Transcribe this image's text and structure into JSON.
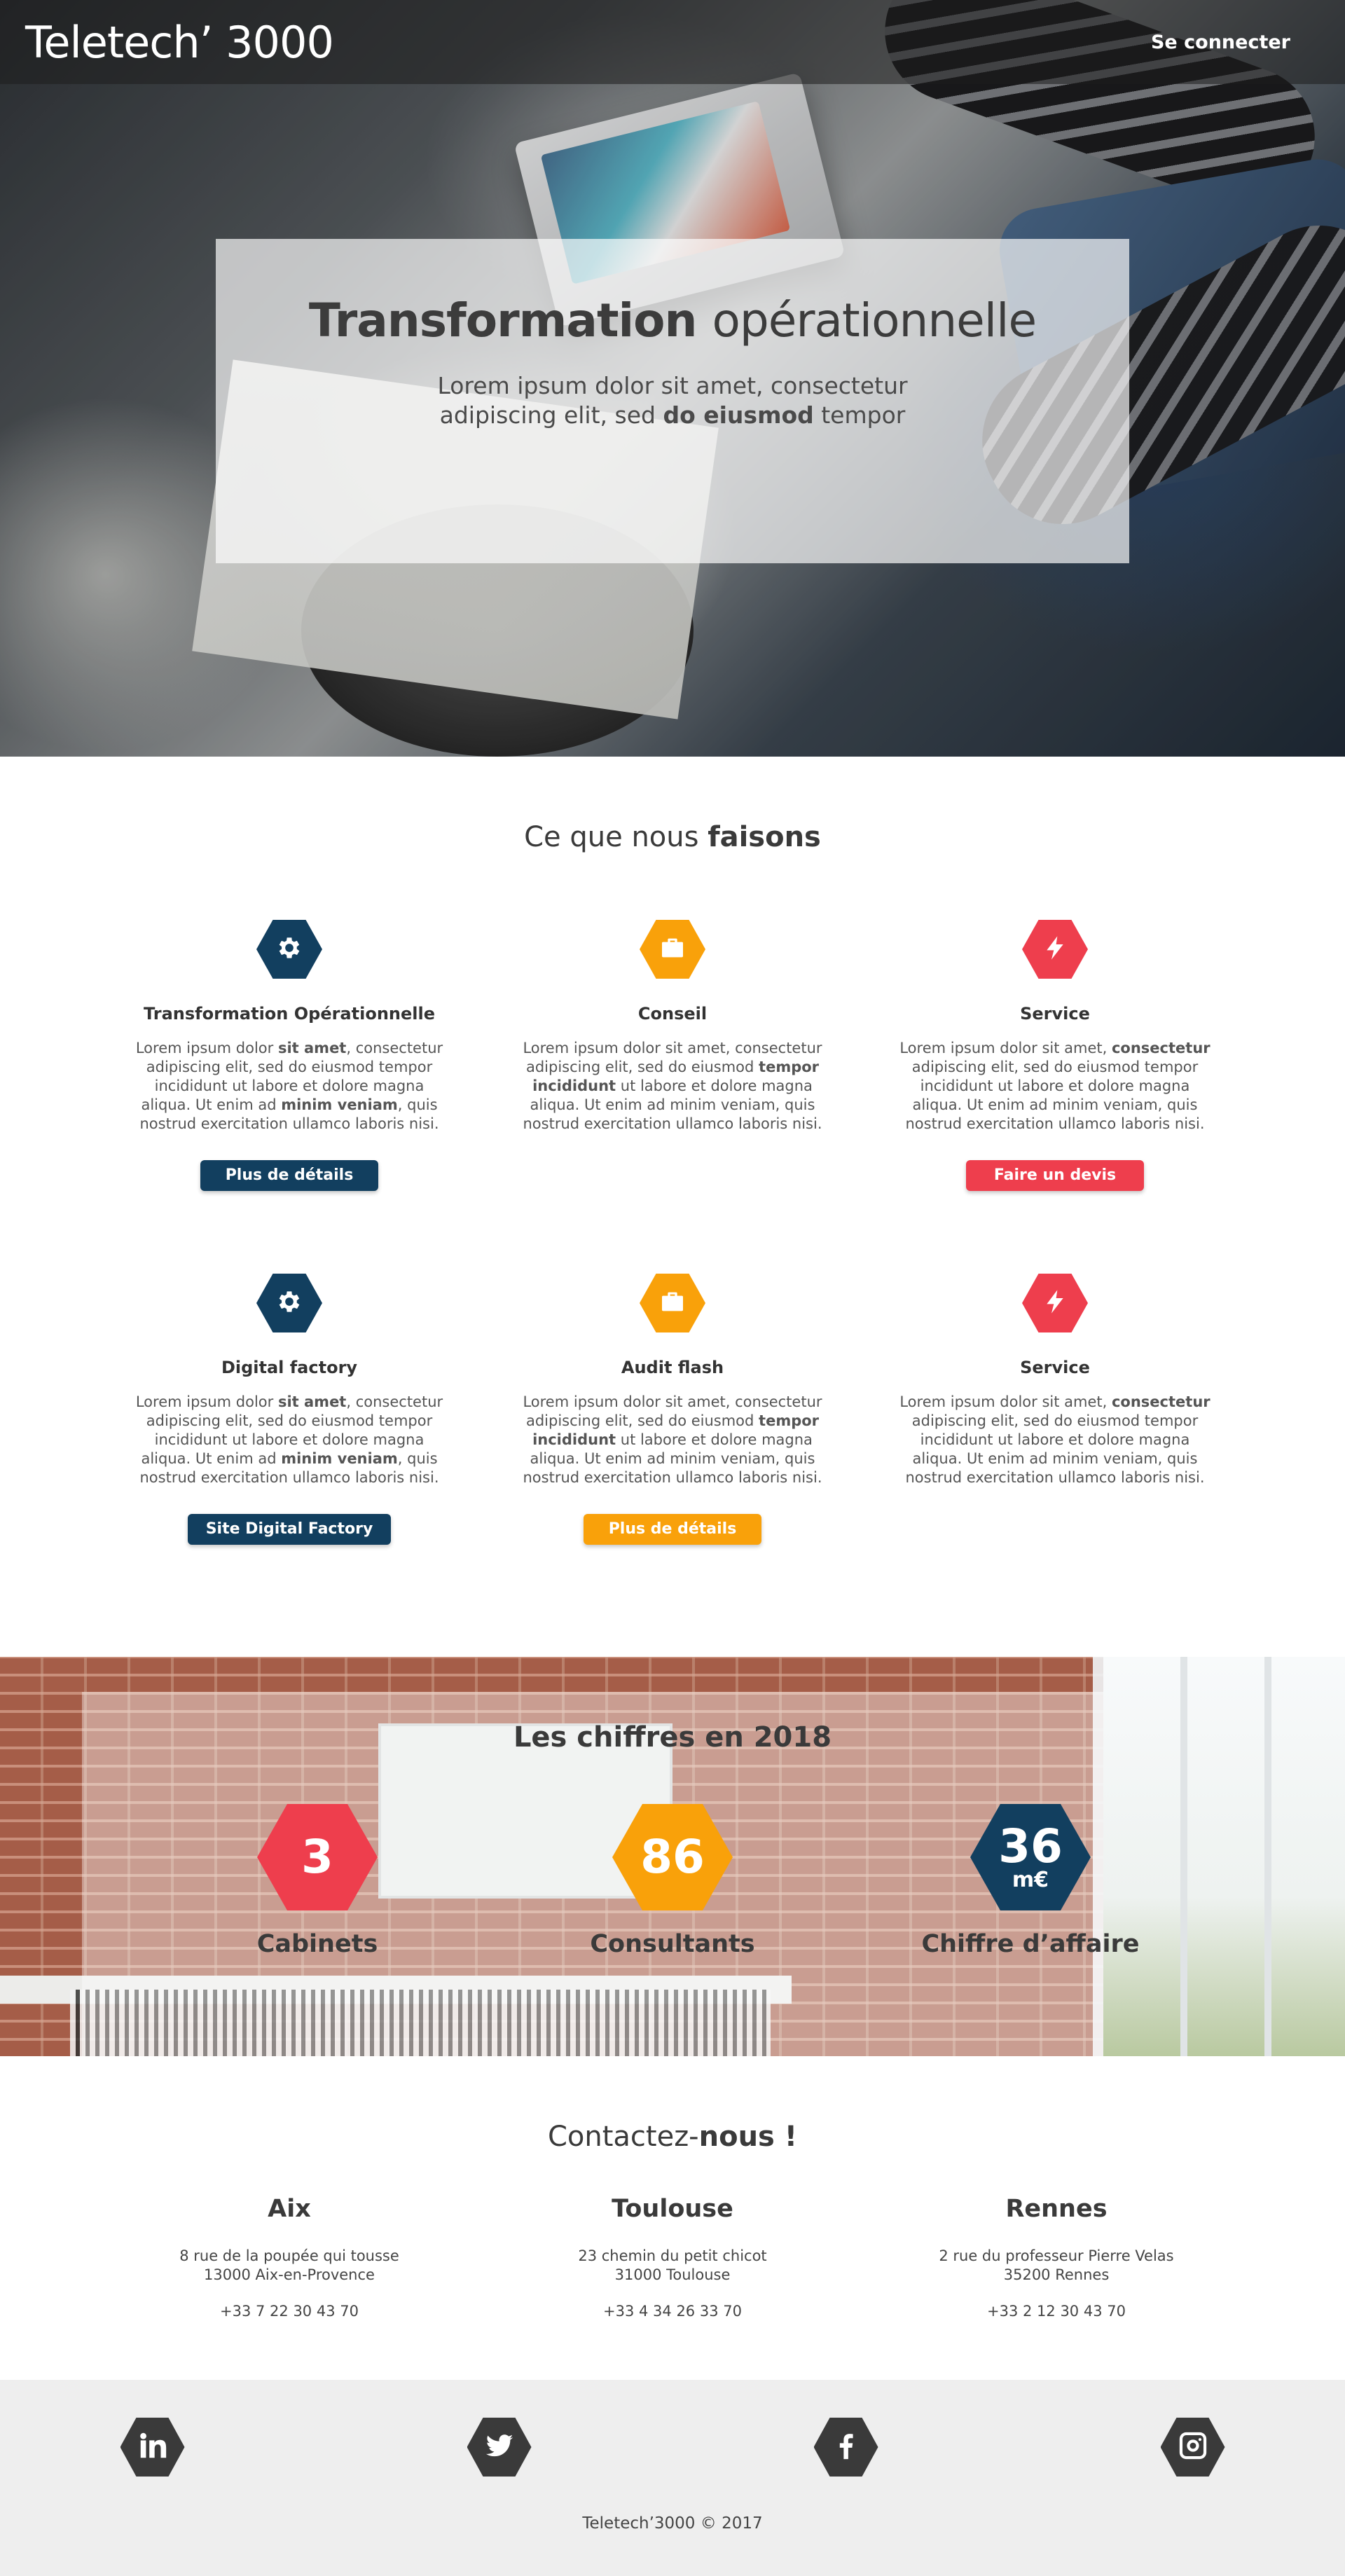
{
  "nav": {
    "logo": "Teletech’ 3000",
    "login": "Se connecter"
  },
  "hero": {
    "title_bold": "Transformation",
    "title_light": "opérationnelle",
    "sub_1": "Lorem ipsum dolor sit amet, consectetur adipiscing elit, sed ",
    "sub_bold": "do eiusmod",
    "sub_2": " tempor"
  },
  "services": {
    "title_regular": "Ce que nous ",
    "title_bold": "faisons",
    "items": [
      {
        "icon": "gear-icon",
        "color": "#123f5f",
        "title": "Transformation Opérationnelle",
        "text_parts": [
          "Lorem ipsum dolor ",
          "sit amet",
          ", consectetur adipiscing elit, sed do eiusmod tempor incididunt ut labore et dolore magna aliqua. Ut enim ad ",
          "minim veniam",
          ", quis nostrud exercitation ullamco laboris nisi."
        ],
        "button": "Plus de détails",
        "button_color": "#123f5f"
      },
      {
        "icon": "briefcase-icon",
        "color": "#f9a10a",
        "title": "Conseil",
        "text_parts": [
          "Lorem ipsum dolor sit amet, consectetur adipiscing elit, sed do eiusmod ",
          "tempor incididunt",
          " ut labore et dolore magna aliqua. Ut enim ad minim veniam, quis nostrud exercitation ullamco laboris nisi."
        ],
        "button": "",
        "button_color": ""
      },
      {
        "icon": "lightning-icon",
        "color": "#ee3e4d",
        "title": "Service",
        "text_parts": [
          "Lorem ipsum dolor sit amet, ",
          "consectetur",
          " adipiscing elit, sed do eiusmod tempor incididunt ut labore et dolore magna aliqua. Ut enim ad minim veniam, quis nostrud exercitation ullamco laboris nisi."
        ],
        "button": "Faire un devis",
        "button_color": "#ee3e4d"
      },
      {
        "icon": "gear-icon",
        "color": "#123f5f",
        "title": "Digital factory",
        "text_parts": [
          "Lorem ipsum dolor ",
          "sit amet",
          ", consectetur adipiscing elit, sed do eiusmod tempor incididunt ut labore et dolore magna aliqua. Ut enim ad ",
          "minim veniam",
          ", quis nostrud exercitation ullamco laboris nisi."
        ],
        "button": "Site Digital Factory",
        "button_color": "#123f5f"
      },
      {
        "icon": "briefcase-icon",
        "color": "#f9a10a",
        "title": "Audit flash",
        "text_parts": [
          "Lorem ipsum dolor sit amet, consectetur adipiscing elit, sed do eiusmod ",
          "tempor incididunt",
          " ut labore et dolore magna aliqua. Ut enim ad minim veniam, quis nostrud exercitation ullamco laboris nisi."
        ],
        "button": "Plus de détails",
        "button_color": "#f9a10a"
      },
      {
        "icon": "lightning-icon",
        "color": "#ee3e4d",
        "title": "Service",
        "text_parts": [
          "Lorem ipsum dolor sit amet, ",
          "consectetur",
          " adipiscing elit, sed do eiusmod tempor incididunt ut labore et dolore magna aliqua. Ut enim ad minim veniam, quis nostrud exercitation ullamco laboris nisi."
        ],
        "button": "",
        "button_color": ""
      }
    ]
  },
  "stats": {
    "title_regular": "Les ",
    "title_bold": "chiffres en 2018",
    "items": [
      {
        "value": "3",
        "unit": "",
        "label": "Cabinets",
        "color": "#ee3e4d"
      },
      {
        "value": "86",
        "unit": "",
        "label": "Consultants",
        "color": "#f9a10a"
      },
      {
        "value": "36",
        "unit": "m€",
        "label": "Chiffre d’affaire",
        "color": "#123f5f"
      }
    ]
  },
  "contact": {
    "title_regular": "Contactez-",
    "title_bold": "nous !",
    "offices": [
      {
        "city": "Aix",
        "address_1": "8 rue de la poupée qui tousse",
        "address_2": "13000 Aix-en-Provence",
        "phone": "+33 7 22 30 43 70"
      },
      {
        "city": "Toulouse",
        "address_1": "23 chemin du petit chicot",
        "address_2": "31000 Toulouse",
        "phone": "+33 4 34 26 33 70"
      },
      {
        "city": "Rennes",
        "address_1": "2 rue du professeur Pierre Velas",
        "address_2": "35200 Rennes",
        "phone": "+33 2 12 30 43 70"
      }
    ]
  },
  "footer": {
    "socials": [
      "linkedin-icon",
      "twitter-icon",
      "facebook-icon",
      "instagram-icon"
    ],
    "copyright": "Teletech’3000 © 2017"
  }
}
